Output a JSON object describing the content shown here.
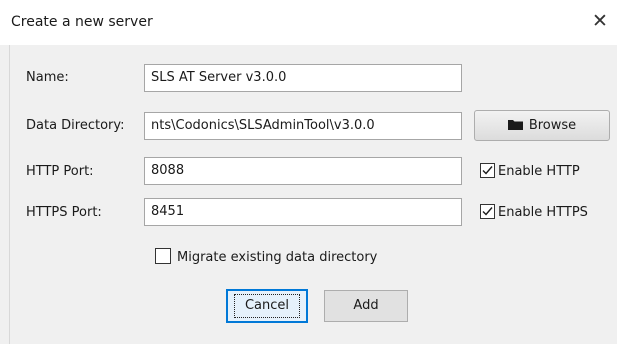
{
  "dialog": {
    "title": "Create a new server",
    "close_glyph": "✕"
  },
  "fields": {
    "name_label": "Name:",
    "name_value": "SLS AT Server v3.0.0",
    "data_dir_label": "Data Directory:",
    "data_dir_value": "nts\\Codonics\\SLSAdminTool\\v3.0.0",
    "http_label": "HTTP Port:",
    "http_value": "8088",
    "https_label": "HTTPS Port:",
    "https_value": "8451"
  },
  "buttons": {
    "browse_label": "Browse",
    "browse_icon": "folder-icon",
    "cancel_label": "Cancel",
    "add_label": "Add"
  },
  "checkboxes": {
    "enable_http_label": "Enable HTTP",
    "enable_http_checked": true,
    "enable_https_label": "Enable HTTPS",
    "enable_https_checked": true,
    "migrate_label": "Migrate existing data directory",
    "migrate_checked": false
  },
  "colors": {
    "focus_border": "#0078d7",
    "dialog_background": "#f0f0f0"
  }
}
